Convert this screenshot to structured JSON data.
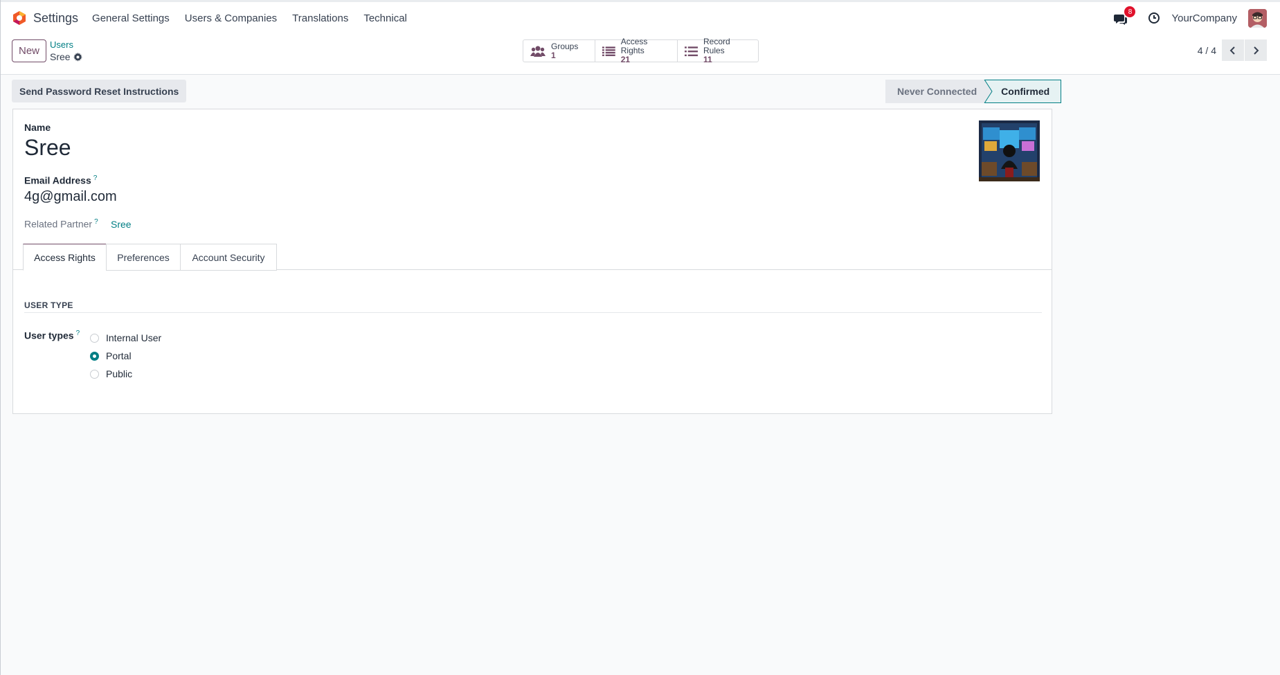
{
  "navbar": {
    "app_name": "Settings",
    "menu": [
      "General Settings",
      "Users & Companies",
      "Translations",
      "Technical"
    ],
    "chat_badge": "8",
    "company": "YourCompany"
  },
  "control_panel": {
    "new_label": "New",
    "breadcrumb_parent": "Users",
    "breadcrumb_current": "Sree",
    "smart_buttons": [
      {
        "label": "Groups",
        "count": "1",
        "icon": "users-icon"
      },
      {
        "label": "Access Rights",
        "count": "21",
        "icon": "list-icon"
      },
      {
        "label": "Record Rules",
        "count": "11",
        "icon": "list-icon"
      }
    ],
    "pager": "4 / 4"
  },
  "statusbar": {
    "reset_button": "Send Password Reset Instructions",
    "states": [
      "Never Connected",
      "Confirmed"
    ],
    "active_state": "Confirmed"
  },
  "form": {
    "name_label": "Name",
    "name_value": "Sree",
    "email_label": "Email Address",
    "email_value": "4g@gmail.com",
    "partner_label": "Related Partner",
    "partner_value": "Sree",
    "help_mark": "?"
  },
  "tabs": [
    "Access Rights",
    "Preferences",
    "Account Security"
  ],
  "access_rights": {
    "section_title": "USER TYPE",
    "user_types_label": "User types",
    "options": [
      "Internal User",
      "Portal",
      "Public"
    ],
    "selected": "Portal"
  },
  "colors": {
    "brand": "#714b67",
    "accent": "#017e84",
    "badge": "#e0112b"
  }
}
